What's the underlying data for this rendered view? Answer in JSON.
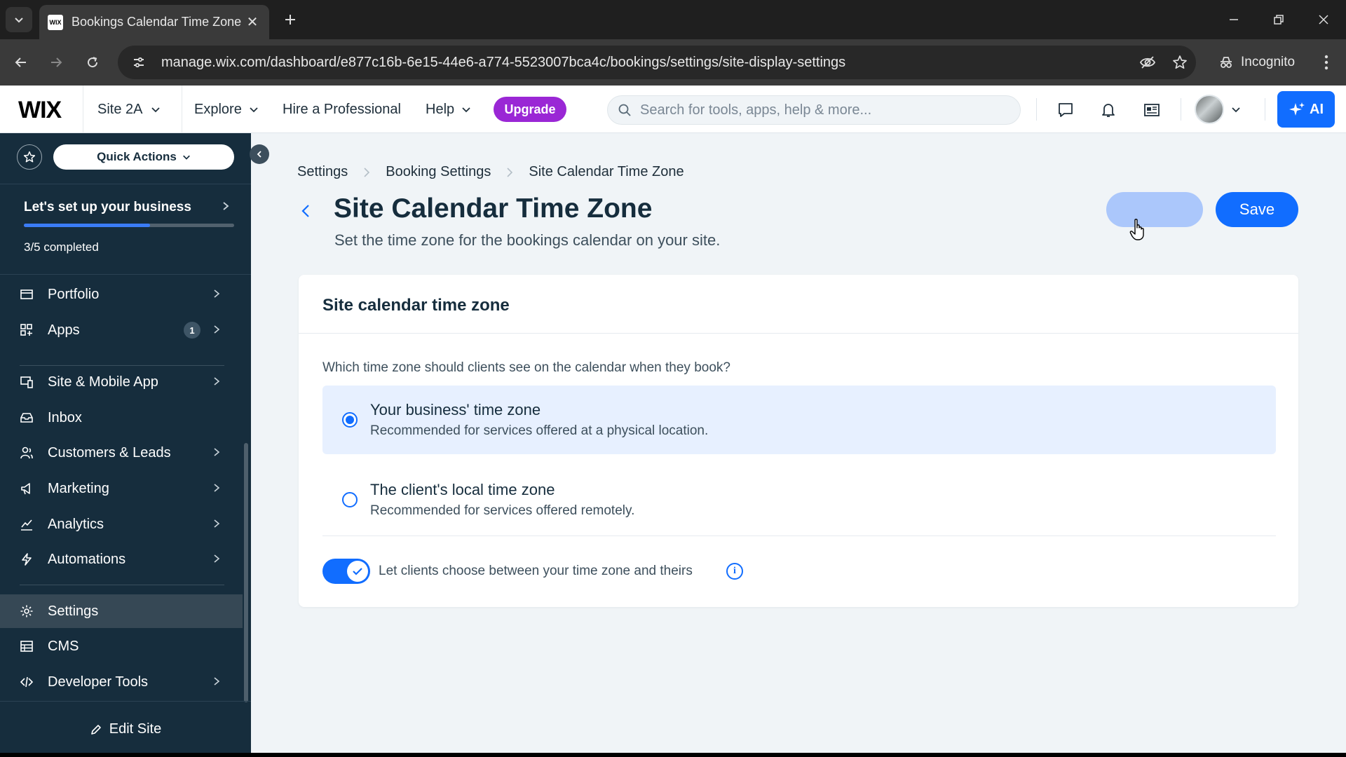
{
  "browser": {
    "tab_title": "Bookings Calendar Time Zone |",
    "favicon_text": "WIX",
    "url": "manage.wix.com/dashboard/e877c16b-6e15-44e6-a774-5523007bca4c/bookings/settings/site-display-settings",
    "incognito_label": "Incognito"
  },
  "topbar": {
    "logo": "WIX",
    "site_name": "Site 2A",
    "explore": "Explore",
    "hire": "Hire a Professional",
    "help": "Help",
    "upgrade": "Upgrade",
    "search_placeholder": "Search for tools, apps, help & more...",
    "ai_label": "AI"
  },
  "sidebar": {
    "quick_actions": "Quick Actions",
    "setup_title": "Let's set up your business",
    "setup_progress": 0.6,
    "setup_count": "3/5 completed",
    "items": [
      {
        "label": "Portfolio"
      },
      {
        "label": "Apps",
        "badge": "1"
      },
      {
        "label": "Site & Mobile App"
      },
      {
        "label": "Inbox"
      },
      {
        "label": "Customers & Leads"
      },
      {
        "label": "Marketing"
      },
      {
        "label": "Analytics"
      },
      {
        "label": "Automations"
      },
      {
        "label": "Settings"
      },
      {
        "label": "CMS"
      },
      {
        "label": "Developer Tools"
      }
    ],
    "active_item": "Settings",
    "edit_site": "Edit Site"
  },
  "main": {
    "breadcrumb": [
      "Settings",
      "Booking Settings",
      "Site Calendar Time Zone"
    ],
    "title": "Site Calendar Time Zone",
    "subtitle": "Set the time zone for the bookings calendar on your site.",
    "save_label": "Save",
    "card": {
      "title": "Site calendar time zone",
      "question": "Which time zone should clients see on the calendar when they book?",
      "options": [
        {
          "title": "Your business' time zone",
          "desc": "Recommended for services offered at a physical location.",
          "selected": true
        },
        {
          "title": "The client's local time zone",
          "desc": "Recommended for services offered remotely.",
          "selected": false
        }
      ],
      "toggle_label": "Let clients choose between your time zone and theirs",
      "toggle_on": true
    }
  },
  "colors": {
    "accent": "#116dff",
    "sidebar_bg": "#162d3d",
    "upgrade": "#9a27d5",
    "selected_option_bg": "#e7f0ff"
  }
}
